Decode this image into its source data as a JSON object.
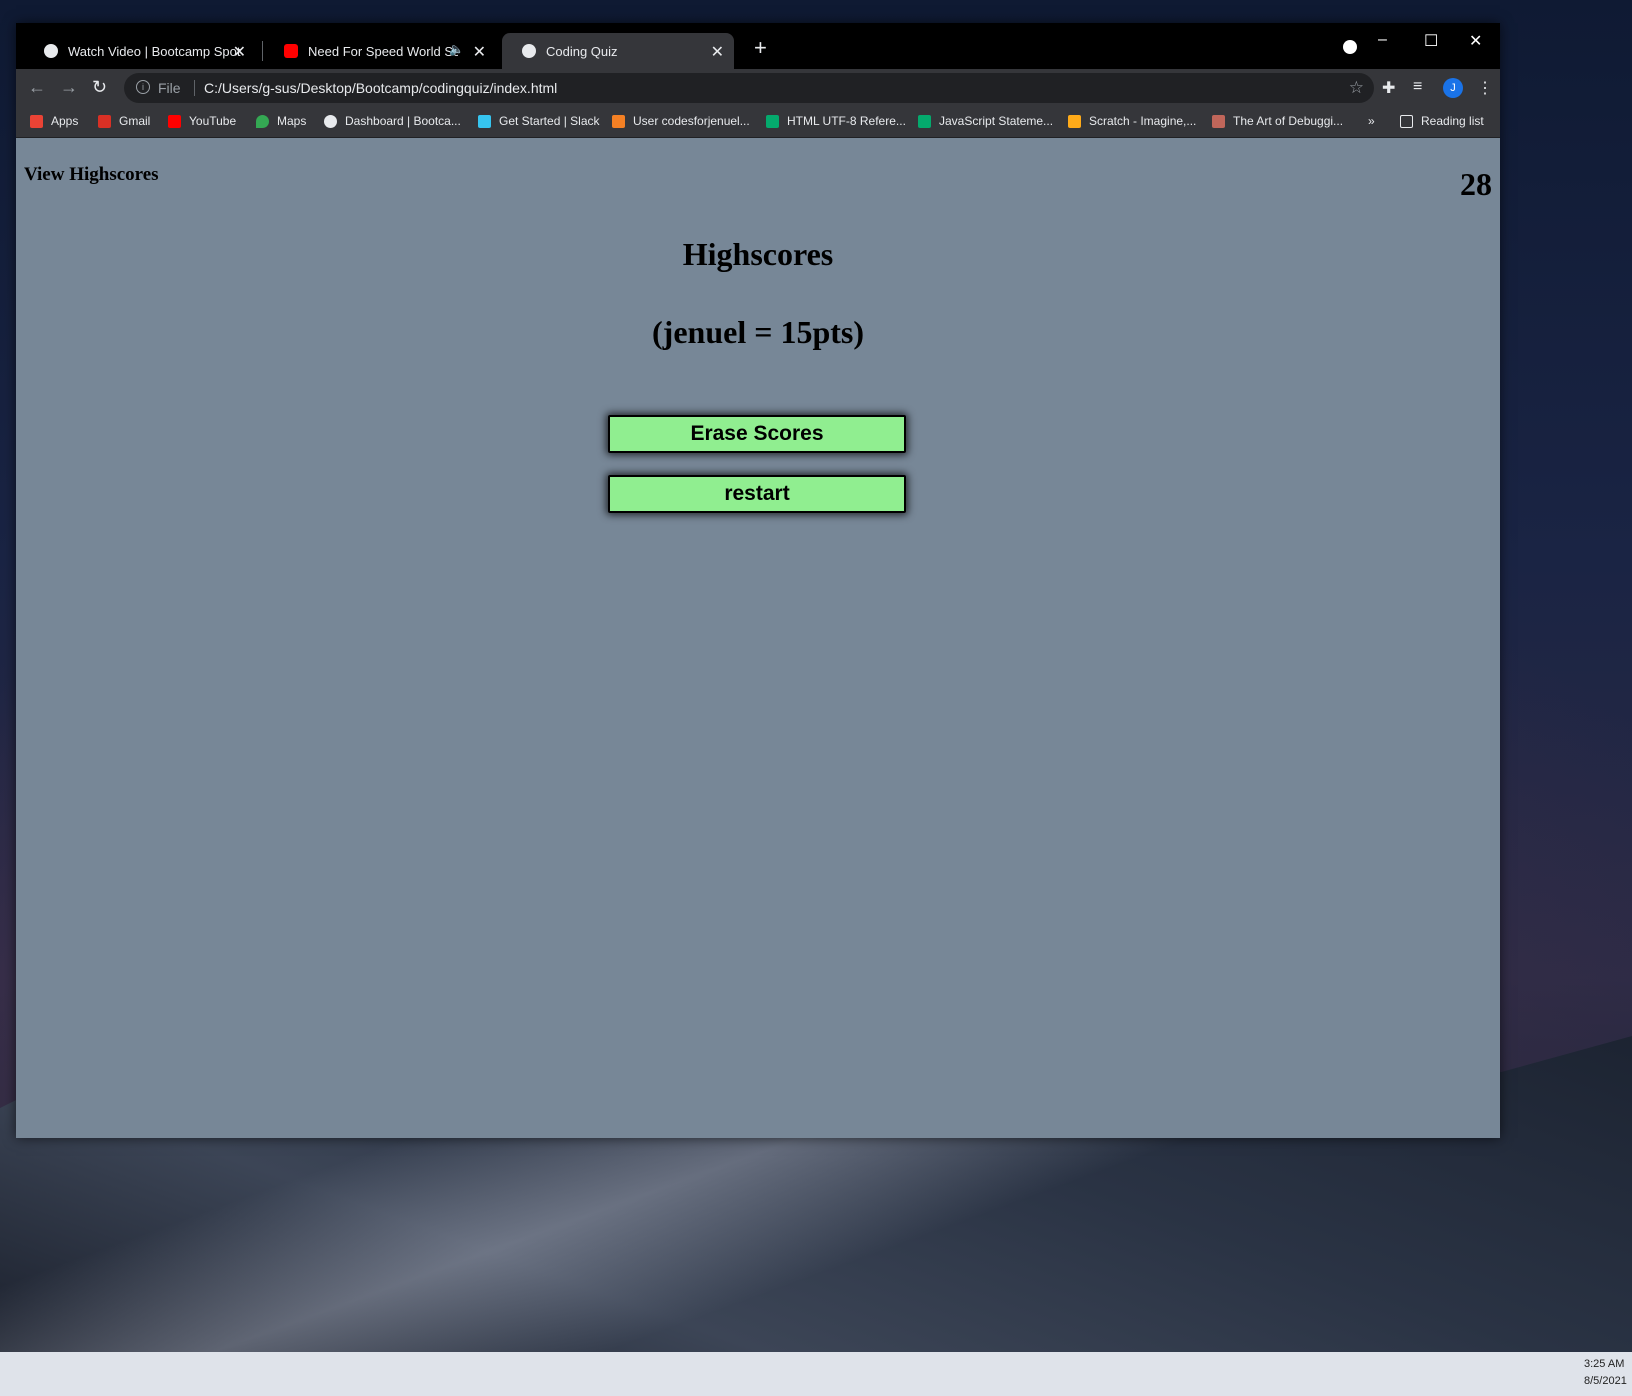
{
  "browser": {
    "tabs": [
      {
        "title": "Watch Video | Bootcamp Spot",
        "icon": "globe-icon",
        "active": false
      },
      {
        "title": "Need For Speed World Soun",
        "icon": "youtube-icon",
        "active": false,
        "audio": true
      },
      {
        "title": "Coding Quiz",
        "icon": "globe-icon",
        "active": true
      }
    ],
    "new_tab": "+",
    "address": {
      "scheme": "File",
      "url": "C:/Users/g-sus/Desktop/Bootcamp/codingquiz/index.html"
    },
    "profile_initial": "J",
    "bookmarks": [
      {
        "label": "Apps",
        "icon": "apps-grid-icon",
        "color": "#ea4335"
      },
      {
        "label": "Gmail",
        "icon": "gmail-icon",
        "color": "#d93025"
      },
      {
        "label": "YouTube",
        "icon": "youtube-icon",
        "color": "#ff0000"
      },
      {
        "label": "Maps",
        "icon": "maps-pin-icon",
        "color": "#34a853"
      },
      {
        "label": "Dashboard | Bootca...",
        "icon": "globe-icon",
        "color": "#e8eaed"
      },
      {
        "label": "Get Started | Slack",
        "icon": "slack-icon",
        "color": "#36c5f0"
      },
      {
        "label": "User codesforjenuel...",
        "icon": "stackoverflow-icon",
        "color": "#f48024"
      },
      {
        "label": "HTML UTF-8 Refere...",
        "icon": "w3schools-icon",
        "color": "#04aa6d"
      },
      {
        "label": "JavaScript Stateme...",
        "icon": "w3schools-icon",
        "color": "#04aa6d"
      },
      {
        "label": "Scratch - Imagine,...",
        "icon": "scratch-icon",
        "color": "#ffab19"
      },
      {
        "label": "The Art of Debuggi...",
        "icon": "avatar-icon",
        "color": "#c0665a"
      }
    ],
    "bookmarks_overflow": "»",
    "reading_list": "Reading list"
  },
  "page": {
    "view_highscores": "View Highscores",
    "timer": "28",
    "heading": "Highscores",
    "entry": "(jenuel = 15pts)",
    "erase_button": "Erase Scores",
    "restart_button": "restart",
    "button_color": "#90ee90",
    "background_color": "#778797"
  },
  "taskbar": {
    "time": "3:25 AM",
    "date": "8/5/2021"
  }
}
